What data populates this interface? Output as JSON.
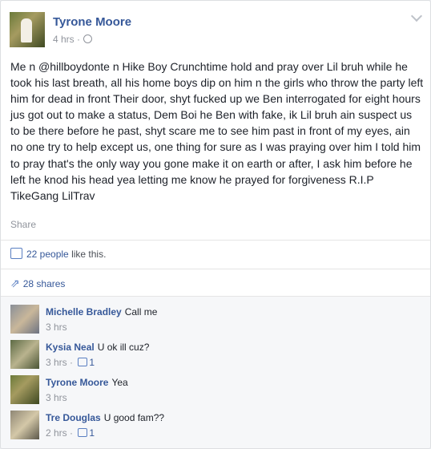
{
  "post": {
    "author": "Tyrone Moore",
    "time": "4 hrs",
    "body": "Me n @hillboydonte n Hike Boy Crunchtime hold and pray over Lil bruh while he took his last breath, all his home boys dip on him n the girls who throw the party left him for dead in front Their door, shyt fucked up we Ben interrogated for eight hours jus got out to make a status, Dem Boi he Ben with fake, ik Lil bruh ain suspect us to be there before he past, shyt scare me to see him past in front of my eyes, ain no one try to help except us, one thing for sure as I was praying over him I told him to pray that's the only way you gone make it on earth or after, I ask him before he left he knod his head yea letting me know he prayed for forgiveness R.I.P TikeGang LilTrav",
    "share_label": "Share",
    "likes_count": "22 people",
    "likes_suffix": "like this.",
    "shares_label": "28 shares"
  },
  "comments": [
    {
      "name": "Michelle Bradley",
      "text": "Call me",
      "time": "3 hrs",
      "likes": ""
    },
    {
      "name": "Kysia Neal",
      "text": "U ok ill cuz?",
      "time": "3 hrs",
      "likes": "1"
    },
    {
      "name": "Tyrone Moore",
      "text": "Yea",
      "time": "3 hrs",
      "likes": ""
    },
    {
      "name": "Tre Douglas",
      "text": "U good fam??",
      "time": "2 hrs",
      "likes": "1"
    }
  ],
  "colors": {
    "link": "#365899",
    "meta": "#90949c",
    "background": "#e9ebee"
  },
  "icons": [
    "globe-icon",
    "chevron-down-icon",
    "like-icon",
    "share-icon"
  ]
}
